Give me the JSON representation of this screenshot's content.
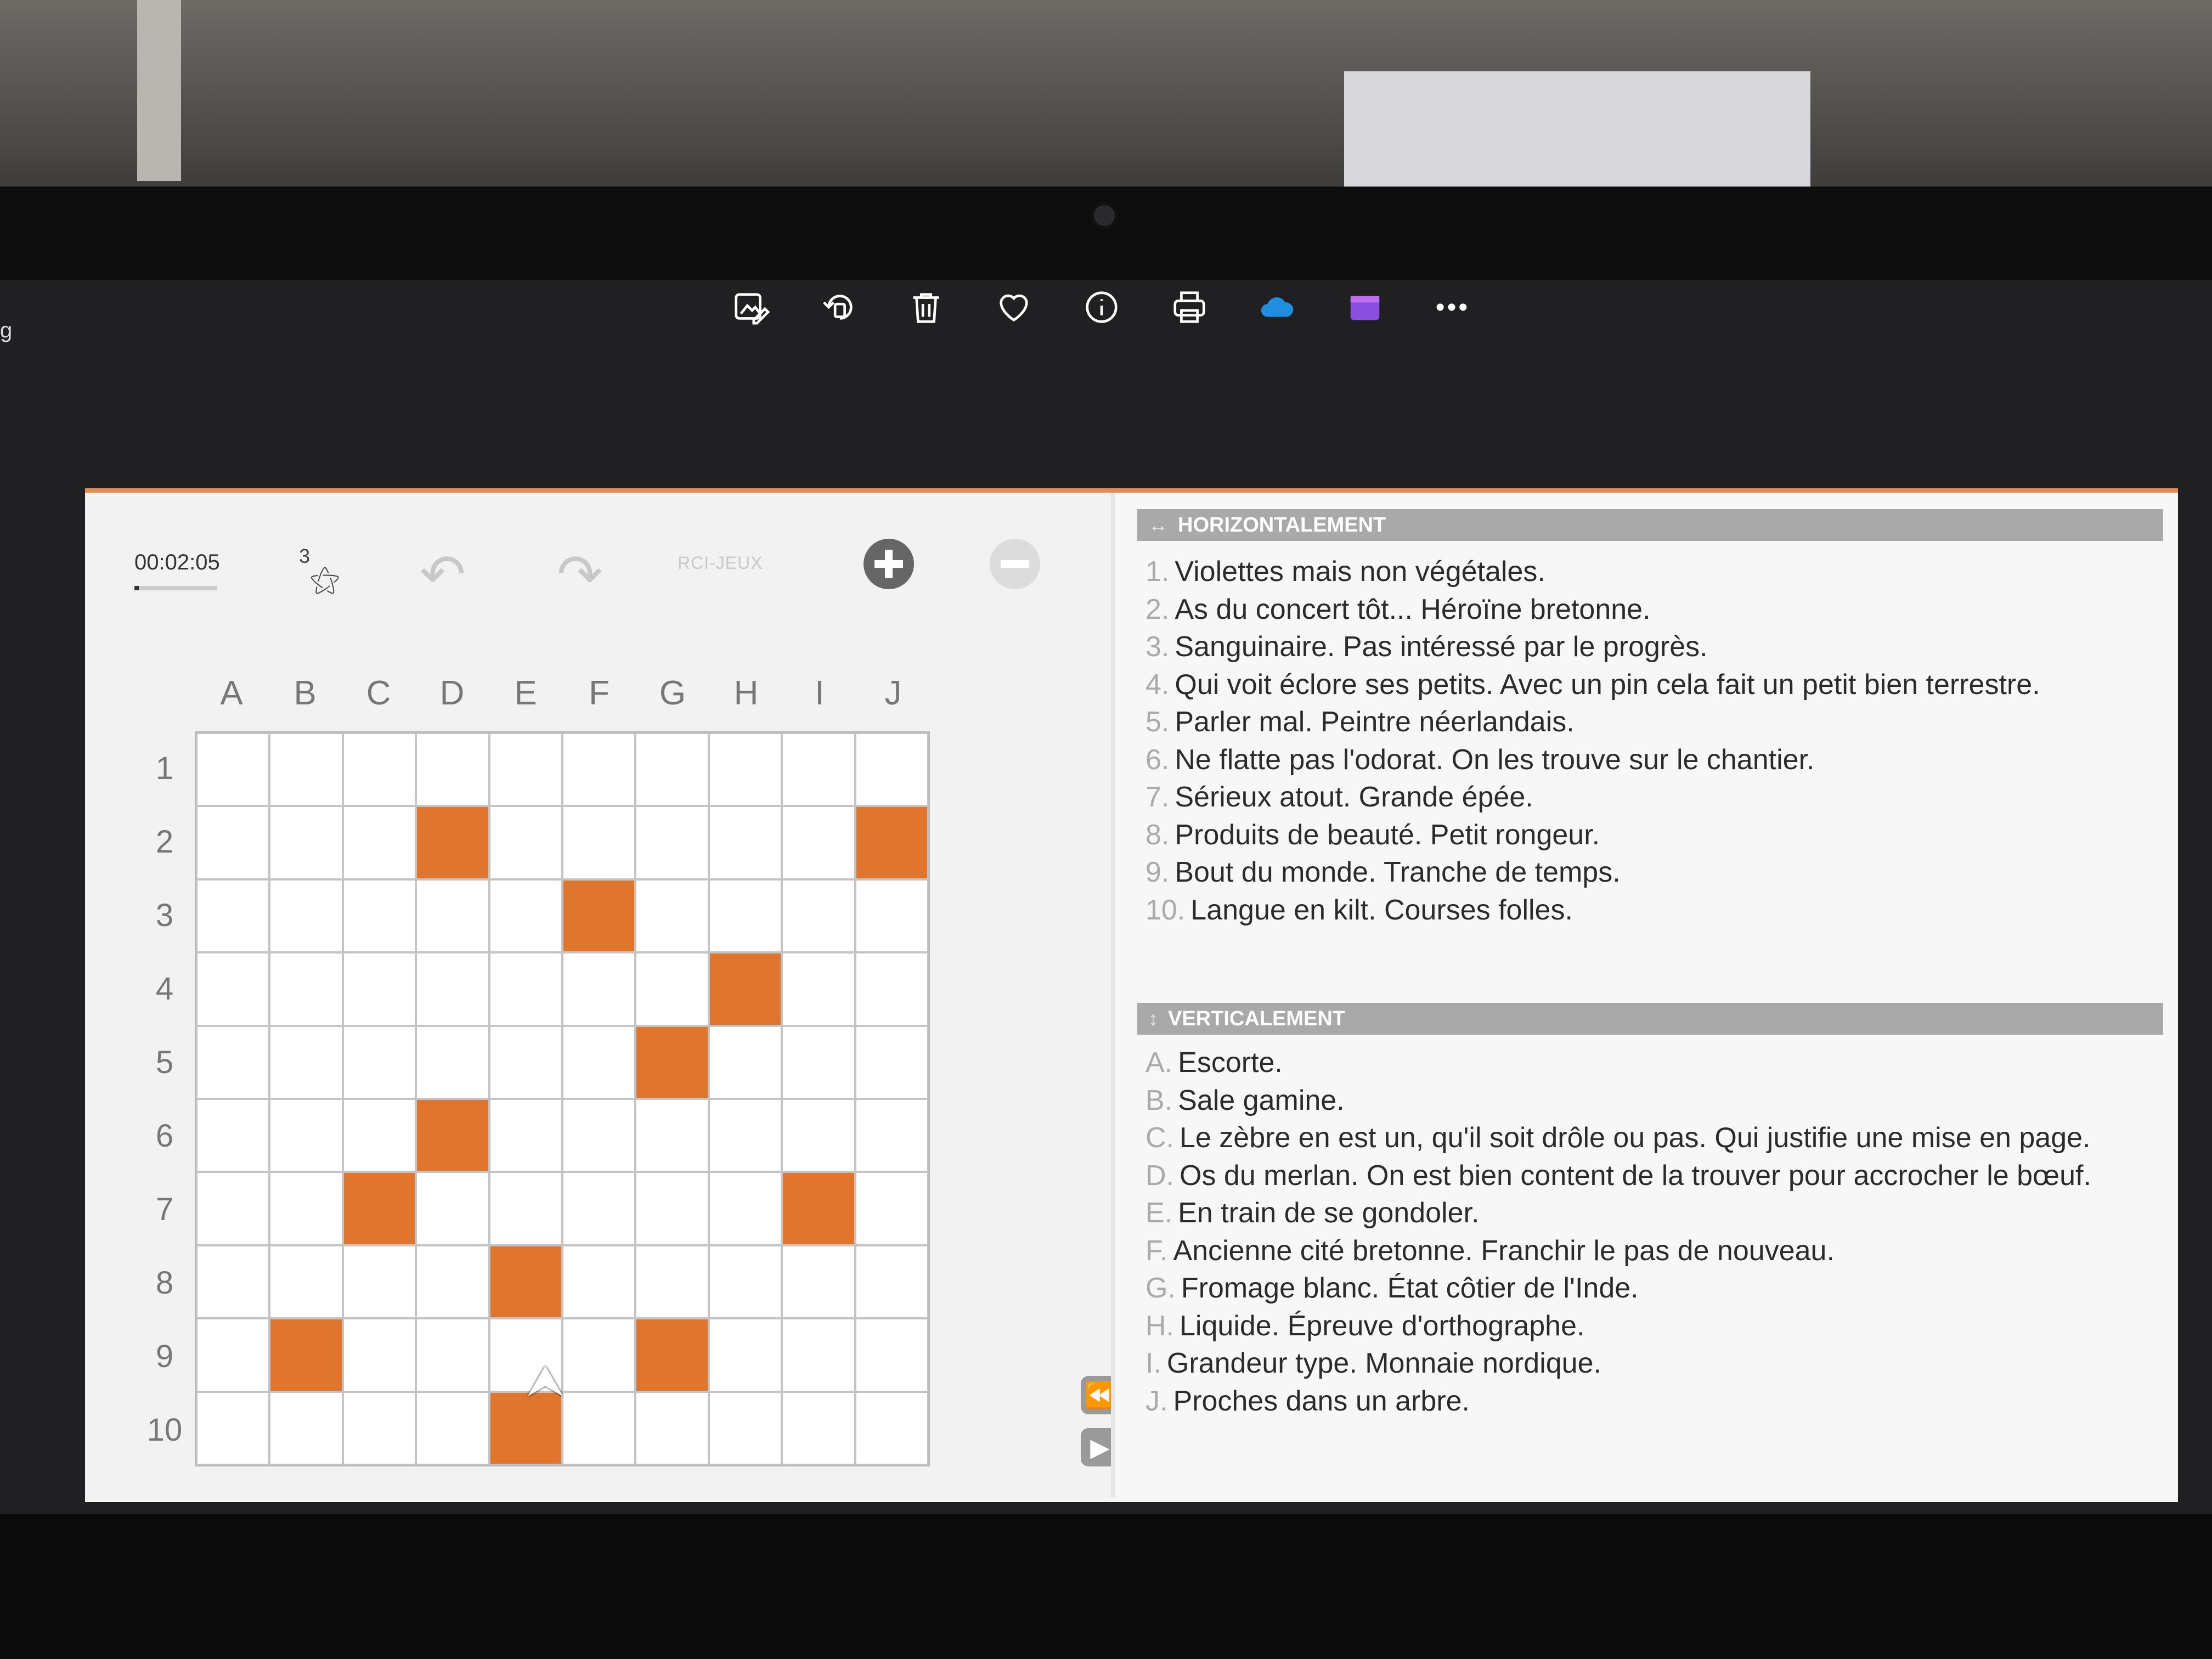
{
  "viewer_toolbar": {
    "icons": [
      "edit-image-icon",
      "rotate-icon",
      "trash-icon",
      "heart-icon",
      "info-icon",
      "print-icon",
      "onedrive-cloud-icon",
      "clipchamp-icon",
      "more-icon"
    ],
    "more_label": "•••"
  },
  "edge_text": "g",
  "game": {
    "timer": "00:02:05",
    "timer_progress": 0.05,
    "hint_count": "3",
    "brand": "RCI-JEUX",
    "grid": {
      "columns": [
        "A",
        "B",
        "C",
        "D",
        "E",
        "F",
        "G",
        "H",
        "I",
        "J"
      ],
      "rows": [
        "1",
        "2",
        "3",
        "4",
        "5",
        "6",
        "7",
        "8",
        "9",
        "10"
      ],
      "black_cells": [
        [
          2,
          "D"
        ],
        [
          2,
          "J"
        ],
        [
          3,
          "F"
        ],
        [
          4,
          "H"
        ],
        [
          5,
          "G"
        ],
        [
          6,
          "D"
        ],
        [
          7,
          "C"
        ],
        [
          7,
          "I"
        ],
        [
          8,
          "E"
        ],
        [
          9,
          "B"
        ],
        [
          9,
          "G"
        ],
        [
          10,
          "E"
        ]
      ],
      "black_color": "#e0752e"
    }
  },
  "clues": {
    "font_smaller": "A-",
    "font_larger": "A+",
    "horizontal": {
      "title": "HORIZONTALEMENT",
      "items": [
        {
          "num": "1.",
          "text": "Violettes mais non végétales."
        },
        {
          "num": "2.",
          "text": "As du concert tôt... Héroïne bretonne."
        },
        {
          "num": "3.",
          "text": "Sanguinaire. Pas intéressé par le progrès."
        },
        {
          "num": "4.",
          "text": "Qui voit éclore ses petits. Avec un pin cela fait un petit bien terrestre."
        },
        {
          "num": "5.",
          "text": "Parler mal. Peintre néerlandais."
        },
        {
          "num": "6.",
          "text": "Ne flatte pas l'odorat. On les trouve sur le chantier."
        },
        {
          "num": "7.",
          "text": "Sérieux atout. Grande épée."
        },
        {
          "num": "8.",
          "text": "Produits de beauté. Petit rongeur."
        },
        {
          "num": "9.",
          "text": "Bout du monde. Tranche de temps."
        },
        {
          "num": "10.",
          "text": "Langue en kilt. Courses folles."
        }
      ]
    },
    "vertical": {
      "title": "VERTICALEMENT",
      "items": [
        {
          "num": "A.",
          "text": "Escorte."
        },
        {
          "num": "B.",
          "text": "Sale gamine."
        },
        {
          "num": "C.",
          "text": "Le zèbre en est un, qu'il soit drôle ou pas. Qui justifie une mise en page."
        },
        {
          "num": "D.",
          "text": "Os du merlan. On est bien content de la trouver pour accrocher le bœuf."
        },
        {
          "num": "E.",
          "text": "En train de se gondoler."
        },
        {
          "num": "F.",
          "text": "Ancienne cité bretonne. Franchir le pas de nouveau."
        },
        {
          "num": "G.",
          "text": "Fromage blanc. État côtier de l'Inde."
        },
        {
          "num": "H.",
          "text": "Liquide. Épreuve d'orthographe."
        },
        {
          "num": "I.",
          "text": "Grandeur type. Monnaie nordique."
        },
        {
          "num": "J.",
          "text": "Proches dans un arbre."
        }
      ]
    }
  }
}
